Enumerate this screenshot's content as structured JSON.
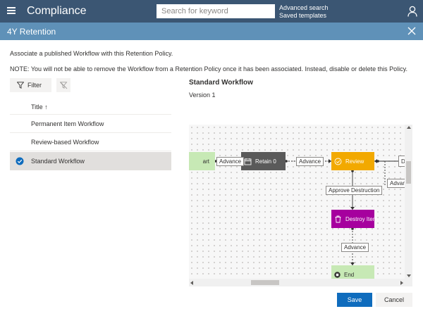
{
  "topbar": {
    "app_title": "Compliance",
    "search_placeholder": "Search for keyword",
    "advanced_search": "Advanced search",
    "saved_templates": "Saved templates"
  },
  "panel": {
    "title": "4Y Retention"
  },
  "intro_text": "Associate a published Workflow with this Retention Policy.",
  "note_text": "NOTE: You will not be able to remove the Workflow from a Retention Policy once it has been associated. Instead, disable or delete this Policy.",
  "filter": {
    "label": "Filter"
  },
  "list": {
    "header": "Title",
    "sort_glyph": "↑",
    "items": [
      {
        "label": "Permanent Item Workflow",
        "selected": false
      },
      {
        "label": "Review-based Workflow",
        "selected": false
      },
      {
        "label": "Standard Workflow",
        "selected": true
      }
    ]
  },
  "detail": {
    "title": "Standard Workflow",
    "version": "Version 1"
  },
  "workflow": {
    "nodes": {
      "start": "art",
      "retain": "Retain 0",
      "review": "Review",
      "destroy": "Destroy Item",
      "end": "End",
      "cut_right": "D"
    },
    "edges": {
      "advance_1": "Advance",
      "advance_2": "Advance",
      "approve_destruction": "Approve Destruction",
      "advance_3": "Advance",
      "advance_right": "Advan"
    }
  },
  "colors": {
    "topbar": "#3b5673",
    "panel_header": "#5f91b8",
    "start_end": "#c7e9b5",
    "retain": "#5a5a5a",
    "review": "#f2a900",
    "destroy": "#a6009e",
    "primary": "#0f6cbd"
  },
  "actions": {
    "save": "Save",
    "cancel": "Cancel"
  }
}
